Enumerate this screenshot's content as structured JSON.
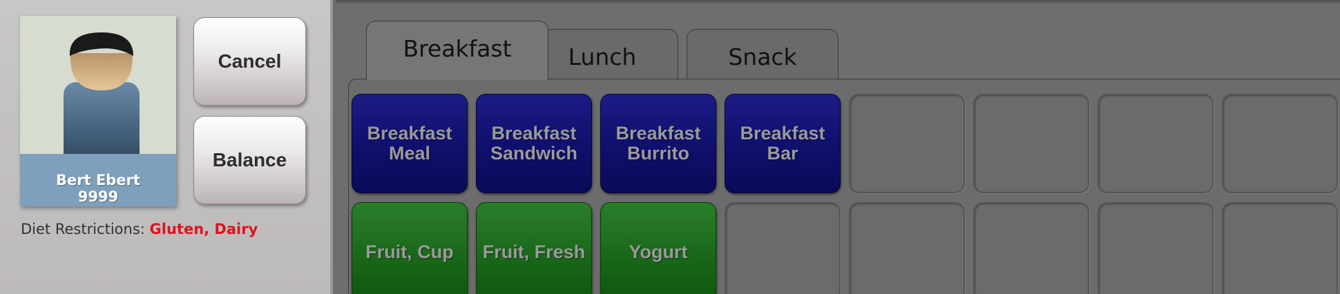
{
  "student": {
    "name": "Bert Ebert",
    "id": "9999",
    "avatar_icon": "person-silhouette-icon"
  },
  "actions": {
    "cancel_label": "Cancel",
    "balance_label": "Balance"
  },
  "diet": {
    "label": "Diet Restrictions:",
    "values": "Gluten, Dairy",
    "values_color": "#e0121f"
  },
  "tabs": [
    {
      "label": "Breakfast",
      "active": true
    },
    {
      "label": "Lunch",
      "active": false
    },
    {
      "label": "Snack",
      "active": false
    }
  ],
  "menu": {
    "row1": [
      "Breakfast Meal",
      "Breakfast Sandwich",
      "Breakfast Burrito",
      "Breakfast Bar"
    ],
    "row2": [
      "Fruit, Cup",
      "Fruit, Fresh",
      "Yogurt"
    ]
  },
  "colors": {
    "tile_blue": "#10106e",
    "tile_green": "#1b6a1b",
    "namebar": "#7fa0bc"
  }
}
